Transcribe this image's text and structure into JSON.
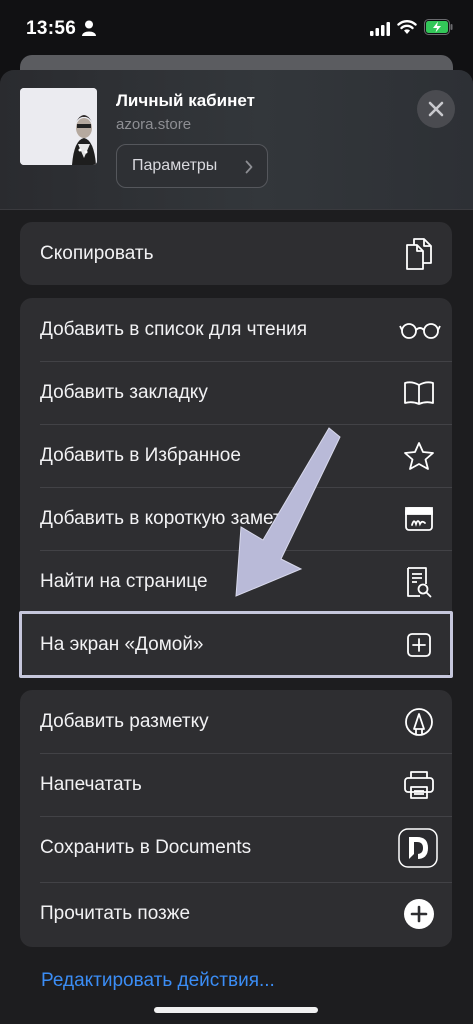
{
  "status_bar": {
    "time": "13:56"
  },
  "header": {
    "title": "Личный кабинет",
    "domain": "azora.store",
    "params_label": "Параметры"
  },
  "groups": [
    {
      "items": [
        {
          "label": "Скопировать",
          "icon": "copy-icon"
        }
      ]
    },
    {
      "items": [
        {
          "label": "Добавить в список для чтения",
          "icon": "glasses-icon"
        },
        {
          "label": "Добавить закладку",
          "icon": "book-icon"
        },
        {
          "label": "Добавить в Избранное",
          "icon": "star-icon"
        },
        {
          "label": "Добавить в короткую заметку",
          "icon": "quick-note-icon"
        },
        {
          "label": "Найти на странице",
          "icon": "find-in-page-icon"
        },
        {
          "label": "На экран «Домой»",
          "icon": "add-square-icon"
        }
      ]
    },
    {
      "items": [
        {
          "label": "Добавить разметку",
          "icon": "markup-icon"
        },
        {
          "label": "Напечатать",
          "icon": "printer-icon"
        },
        {
          "label": "Сохранить в Documents",
          "icon": "documents-app-icon"
        },
        {
          "label": "Прочитать позже",
          "icon": "plus-circle-icon"
        }
      ]
    }
  ],
  "footer": {
    "edit_actions": "Редактировать действия..."
  },
  "colors": {
    "accent": "#3b8df5",
    "highlight": "#c6c7dc",
    "battery": "#33c759"
  }
}
